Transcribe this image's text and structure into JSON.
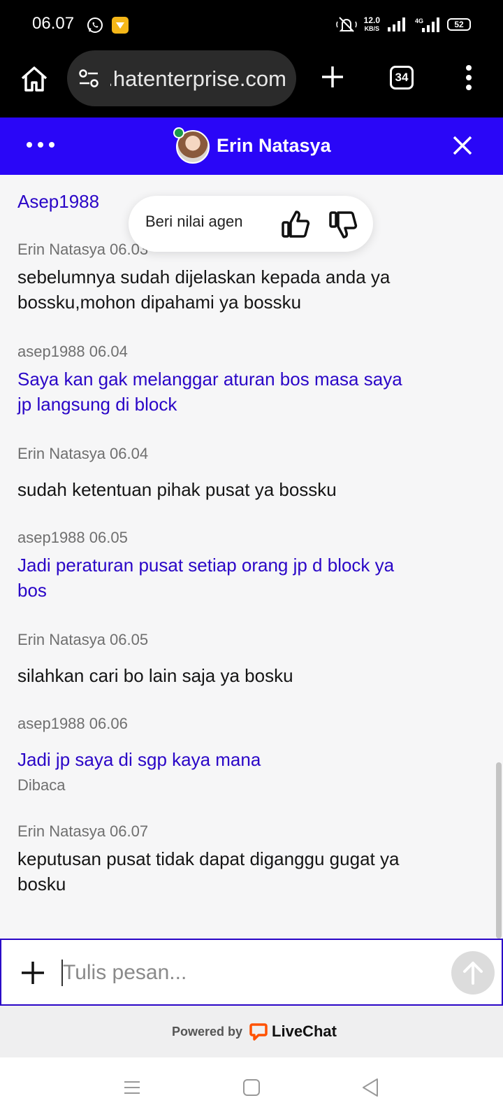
{
  "status_bar": {
    "time": "06.07",
    "speed_value": "12.0",
    "speed_unit": "KB/S",
    "battery": "52"
  },
  "browser": {
    "url": "www.hatenterprise.com",
    "tab_count": "34"
  },
  "chat": {
    "agent_name": "Erin Natasya",
    "rating_prompt": "Beri nilai agen",
    "messages": [
      {
        "meta": "",
        "text": "Asep1988",
        "sender": "user"
      },
      {
        "meta": "Erin Natasya 06.03",
        "text": "sebelumnya sudah dijelaskan kepada anda ya bossku,mohon dipahami ya bossku",
        "sender": "agent"
      },
      {
        "meta": "asep1988 06.04",
        "text": "Saya kan gak melanggar aturan bos masa saya jp langsung di block",
        "sender": "user"
      },
      {
        "meta": "Erin Natasya 06.04",
        "text": "sudah ketentuan pihak pusat ya bossku",
        "sender": "agent"
      },
      {
        "meta": "asep1988 06.05",
        "text": "Jadi peraturan pusat setiap orang jp d block ya bos",
        "sender": "user"
      },
      {
        "meta": "Erin Natasya 06.05",
        "text": "silahkan cari bo lain saja ya bosku",
        "sender": "agent"
      },
      {
        "meta": "asep1988 06.06",
        "text": "Jadi jp saya di sgp kaya mana",
        "sender": "user"
      },
      {
        "meta": "Erin Natasya 06.07",
        "text": "keputusan pusat tidak dapat diganggu gugat ya bosku",
        "sender": "agent"
      }
    ],
    "read_status": "Dibaca"
  },
  "input": {
    "placeholder": "Tulis pesan..."
  },
  "footer": {
    "powered_by": "Powered by",
    "brand": "LiveChat",
    "brand_color": "#ff5100"
  },
  "colors": {
    "header_bg": "#2a06f7",
    "user_text": "#2a06c7",
    "online": "#1b9a4b"
  }
}
